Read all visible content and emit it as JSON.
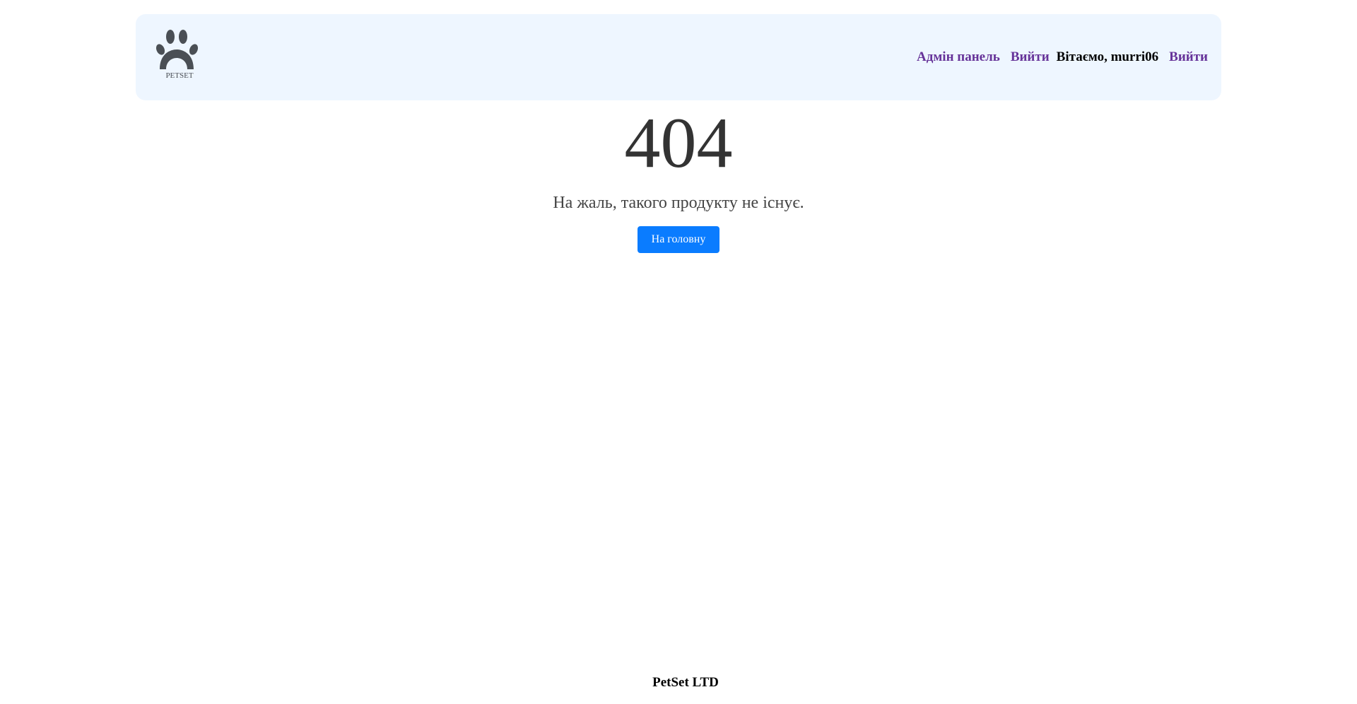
{
  "header": {
    "logo_text": "PETSET",
    "logo_icon": "paw-icon",
    "nav": {
      "admin_label": "Адмін панель",
      "logout_label_1": "Вийти",
      "greeting": "Вітаємо, murri06",
      "logout_label_2": "Вийти"
    }
  },
  "main": {
    "error_code": "404",
    "message": "На жаль, такого продукту не існує.",
    "home_button_label": "На головну"
  },
  "footer": {
    "text": "PetSet LTD"
  },
  "colors": {
    "header_bg": "#eef6ff",
    "link": "#663399",
    "button_bg": "#0a7cff",
    "logo": "#4a4f55"
  }
}
